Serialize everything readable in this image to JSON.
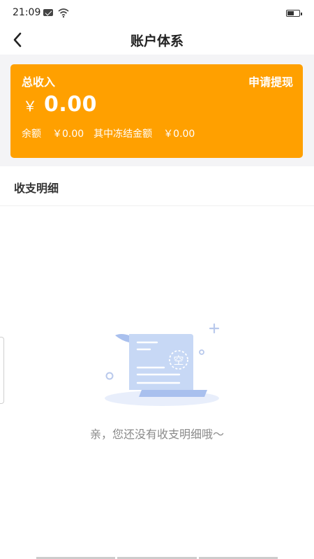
{
  "status_bar": {
    "time": "21:09"
  },
  "header": {
    "title": "账户体系"
  },
  "account_card": {
    "total_income_label": "总收入",
    "withdraw_label": "申请提现",
    "currency_symbol": "￥",
    "total_income_value": "0.00",
    "balance_label": "余额",
    "balance_value": "￥0.00",
    "frozen_label": "其中冻结金额",
    "frozen_value": "￥0.00"
  },
  "section": {
    "title": "收支明细"
  },
  "empty_state": {
    "stamp_text": "空",
    "message": "亲，您还没有收支明细哦～"
  },
  "colors": {
    "accent": "#ffa000",
    "illustration": "#c7d8f5"
  },
  "icons": [
    "mail-icon",
    "wifi-icon",
    "battery-icon",
    "back-icon"
  ]
}
